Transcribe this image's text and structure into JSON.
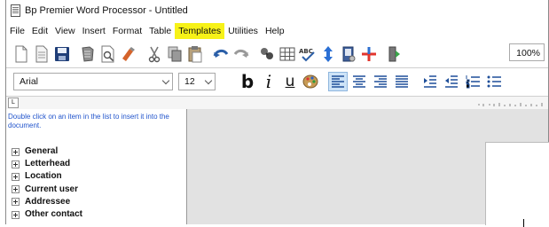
{
  "window": {
    "title": "Bp Premier Word Processor - Untitled"
  },
  "menu": [
    "File",
    "Edit",
    "View",
    "Insert",
    "Format",
    "Table",
    "Templates",
    "Utilities",
    "Help"
  ],
  "menu_highlight": "Templates",
  "toolbar": {
    "zoom": "100%"
  },
  "format_bar": {
    "font": "Arial",
    "size": "12",
    "bold": "b",
    "italic": "i",
    "underline": "u"
  },
  "ruler": {
    "indicator": "L"
  },
  "left_panel": {
    "hint": "Double click on an item in the list to insert it into the document.",
    "items": [
      "General",
      "Letterhead",
      "Location",
      "Current user",
      "Addressee",
      "Other contact"
    ]
  },
  "colors": {
    "highlight": "#f7f218",
    "hint_text": "#2255cc",
    "doc_background": "#e2e2e2"
  }
}
